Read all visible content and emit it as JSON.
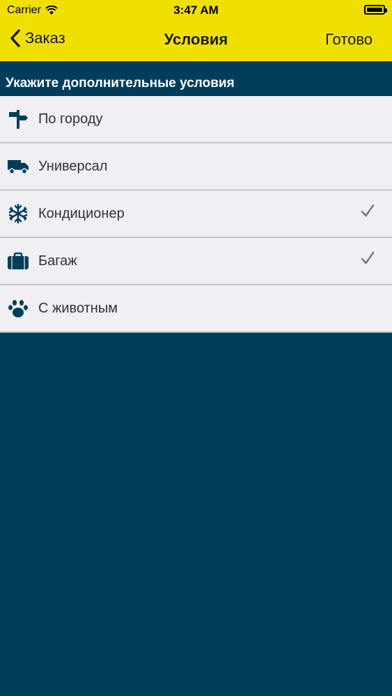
{
  "status_bar": {
    "carrier": "Carrier",
    "time": "3:47 AM"
  },
  "nav": {
    "back_label": "Заказ",
    "title": "Условия",
    "done_label": "Готово"
  },
  "section": {
    "header": "Укажите дополнительные условия"
  },
  "options": [
    {
      "label": "По городу",
      "icon": "signpost-icon",
      "checked": false
    },
    {
      "label": "Универсал",
      "icon": "truck-icon",
      "checked": false
    },
    {
      "label": "Кондиционер",
      "icon": "snowflake-icon",
      "checked": true
    },
    {
      "label": "Багаж",
      "icon": "suitcase-icon",
      "checked": true
    },
    {
      "label": "С животным",
      "icon": "paw-icon",
      "checked": false
    }
  ],
  "colors": {
    "nav_background": "#f0e000",
    "page_background": "#003d5b",
    "row_background": "#efeff4",
    "icon_color": "#003d5b",
    "check_color": "#7a7a7a"
  }
}
